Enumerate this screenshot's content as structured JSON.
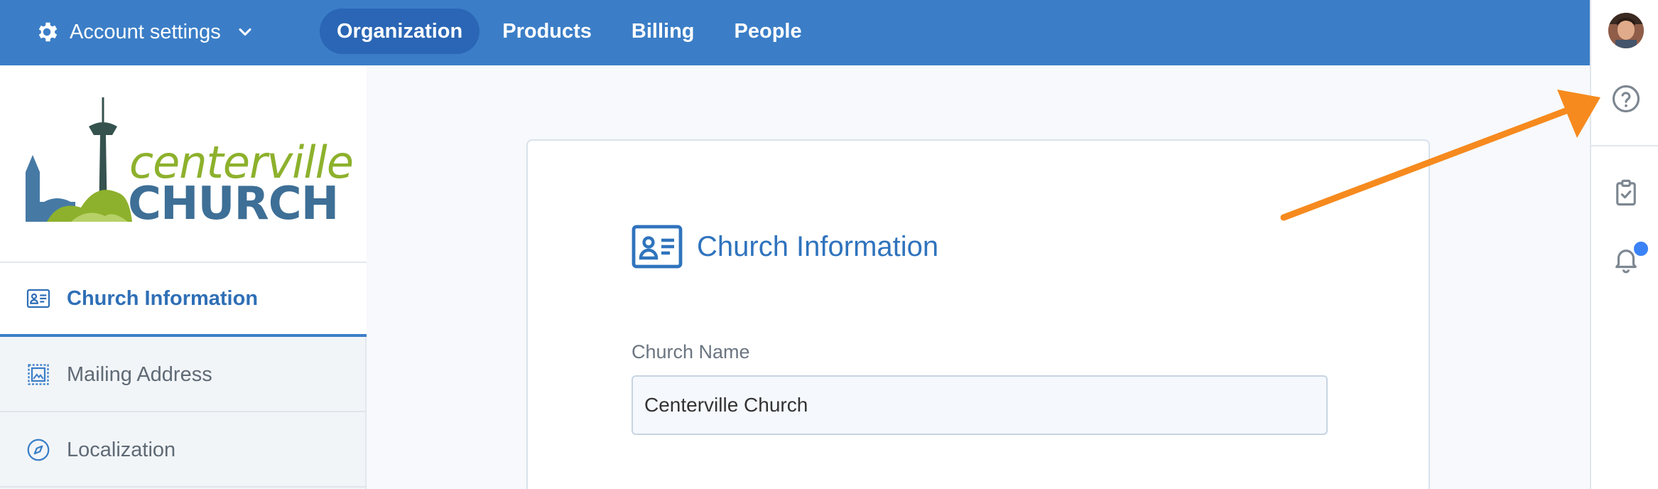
{
  "header": {
    "account_label": "Account settings",
    "account_icon": "gear-icon",
    "tabs": [
      {
        "label": "Organization",
        "active": true
      },
      {
        "label": "Products",
        "active": false
      },
      {
        "label": "Billing",
        "active": false
      },
      {
        "label": "People",
        "active": false
      }
    ],
    "bar_color": "#3b7ec7"
  },
  "rail": {
    "items": [
      "avatar",
      "help-icon",
      "clipboard-check-icon",
      "bell-icon"
    ],
    "notification_dot_color": "#3b82f6"
  },
  "logo": {
    "line1": "centerville",
    "line2": "CHURCH"
  },
  "sidebar": {
    "items": [
      {
        "label": "Church Information",
        "icon": "id-card-icon",
        "active": true
      },
      {
        "label": "Mailing Address",
        "icon": "stamp-icon",
        "active": false
      },
      {
        "label": "Localization",
        "icon": "compass-icon",
        "active": false
      }
    ]
  },
  "card": {
    "title": "Church Information",
    "icon": "id-card-icon",
    "field_label": "Church Name",
    "field_value": "Centerville Church"
  },
  "annotation": {
    "arrow_color": "#f68a1e",
    "points_to": "help-icon"
  }
}
